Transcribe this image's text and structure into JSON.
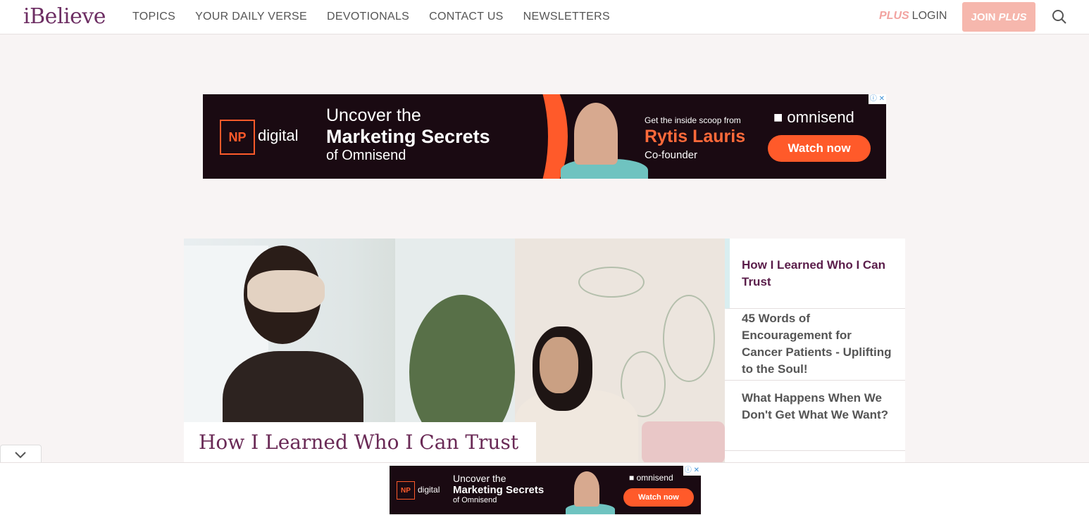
{
  "header": {
    "logo": "iBelieve",
    "nav": [
      "TOPICS",
      "YOUR DAILY VERSE",
      "DEVOTIONALS",
      "CONTACT US",
      "NEWSLETTERS"
    ],
    "login_plus": "PLUS",
    "login": "LOGIN",
    "join": "JOIN",
    "join_plus": "PLUS",
    "search_icon": "search-icon"
  },
  "ad_top": {
    "np_logo": "NP",
    "np_text": "digital",
    "line1": "Uncover the",
    "line2": "Marketing Secrets",
    "line3": "of Omnisend",
    "scoop": "Get the inside scoop from",
    "name": "Rytis Lauris",
    "role": "Co-founder",
    "brand": "omnisend",
    "cta": "Watch now"
  },
  "ad_bottom": {
    "np_logo": "NP",
    "np_text": "digital",
    "line1": "Uncover the",
    "line2": "Marketing Secrets",
    "line3": "of Omnisend",
    "brand": "omnisend",
    "cta": "Watch now"
  },
  "feature": {
    "caption": "How I Learned Who I Can Trust"
  },
  "sidebar": {
    "items": [
      {
        "label": "How I Learned Who I Can Trust"
      },
      {
        "label": "45 Words of Encouragement for Cancer Patients - Uplifting to the Soul!"
      },
      {
        "label": "What Happens When We Don't Get What We Want?"
      }
    ]
  },
  "colors": {
    "brand": "#6d2e63",
    "accent": "#f6b7ad",
    "ad_orange": "#ff5a2a"
  }
}
